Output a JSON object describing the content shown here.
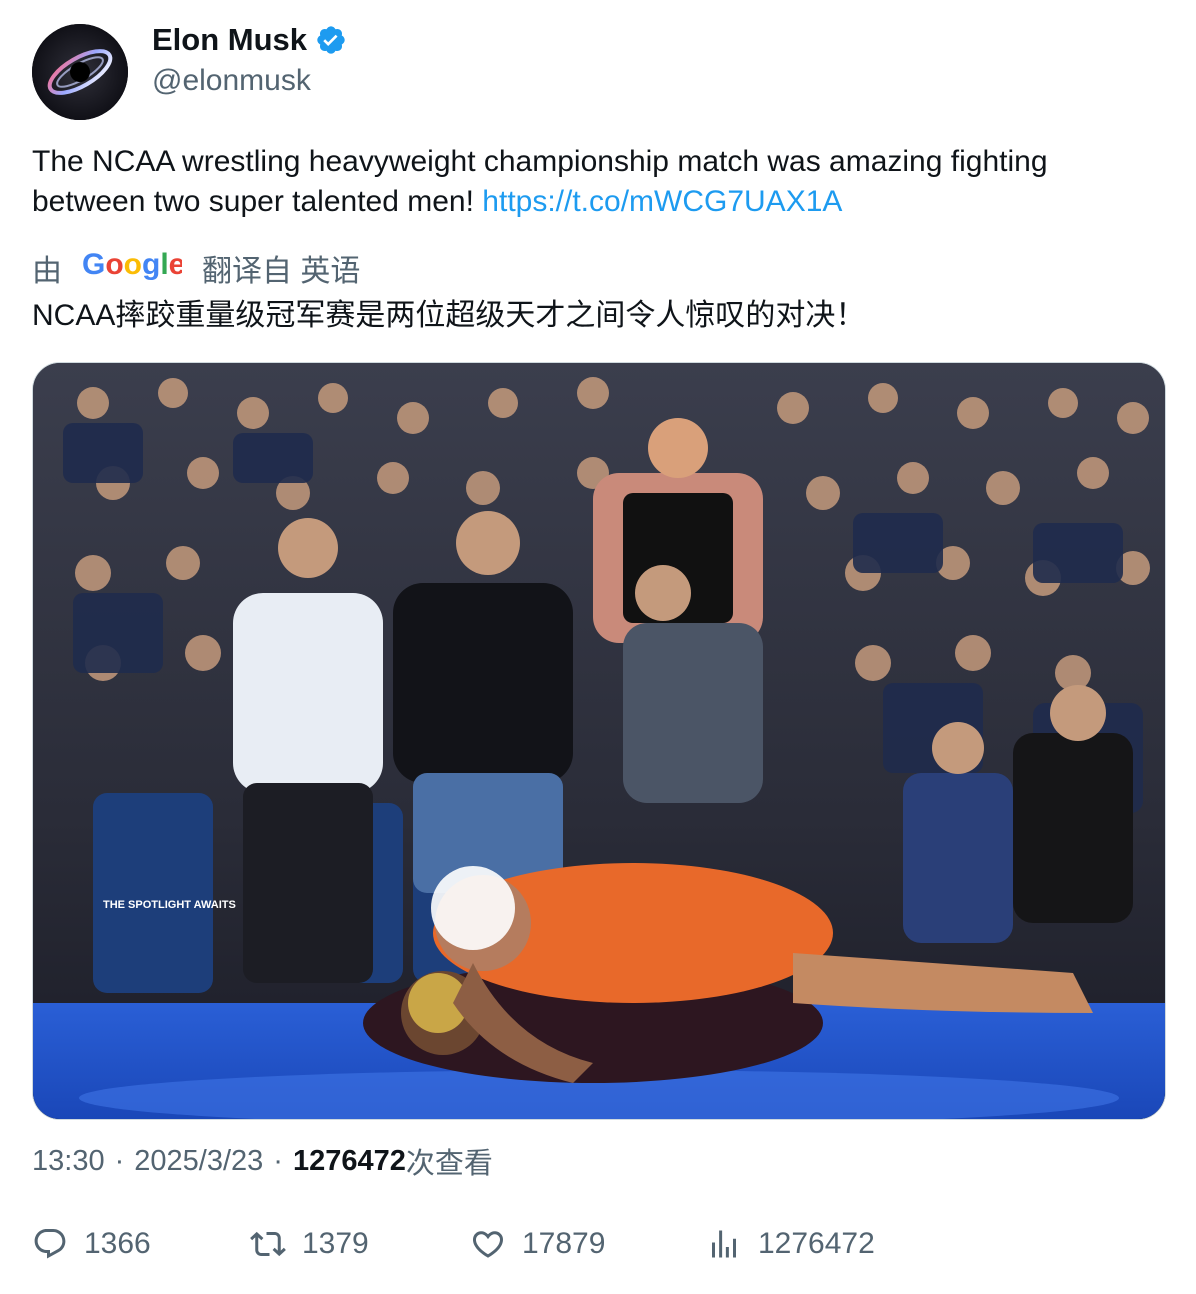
{
  "author": {
    "display_name": "Elon Musk",
    "handle": "@elonmusk",
    "verified": true,
    "verified_color": "#1d9bf0",
    "avatar_icon": "black-hole-avatar"
  },
  "tweet": {
    "text": "The NCAA wrestling heavyweight championship match was amazing fighting between two super talented men!",
    "link": "https://t.co/mWCG7UAX1A",
    "link_color": "#1d9bf0"
  },
  "translation": {
    "prefix": "由",
    "provider": "Google",
    "suffix": "翻译自 英语",
    "text": "NCAA摔跤重量级冠军赛是两位超级天才之间令人惊叹的对决！"
  },
  "media": {
    "description_icon": "wrestling-photo",
    "banner_text": "THE SPOTLIGHT AWAITS"
  },
  "meta": {
    "time": "13:30",
    "date": "2025/3/23",
    "views_count": "1276472",
    "views_label": "次查看"
  },
  "actions": {
    "replies": "1366",
    "retweets": "1379",
    "likes": "17879",
    "views": "1276472"
  }
}
